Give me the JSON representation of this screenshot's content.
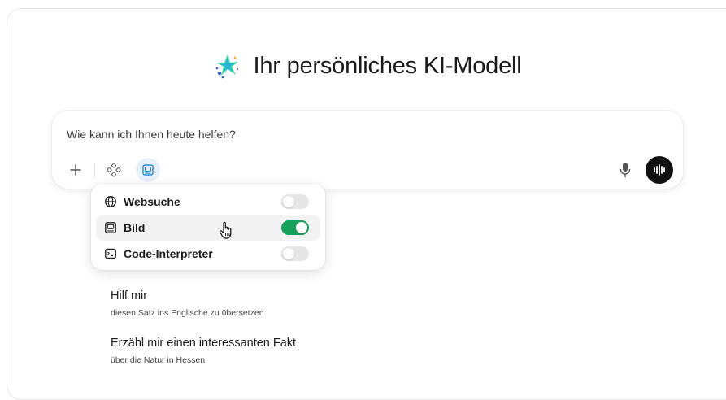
{
  "hero": {
    "title": "Ihr persönliches KI-Modell",
    "logo_icon": "sparkle-logo-icon"
  },
  "composer": {
    "placeholder": "Wie kann ich Ihnen heute helfen?",
    "tools": [
      "plus-icon",
      "apps-icon",
      "image-icon"
    ],
    "right_tools": [
      "microphone-icon",
      "voice-wave-icon"
    ]
  },
  "menu": {
    "items": [
      {
        "label": "Websuche",
        "icon": "globe-icon",
        "enabled": false
      },
      {
        "label": "Bild",
        "icon": "image-icon",
        "enabled": true
      },
      {
        "label": "Code-Interpreter",
        "icon": "terminal-icon",
        "enabled": false
      }
    ]
  },
  "suggestions": [
    {
      "title": "Hilf mir",
      "subtitle": "diesen Satz ins Englische zu übersetzen"
    },
    {
      "title": "Erzähl mir einen interessanten Fakt",
      "subtitle": "über die Natur in Hessen."
    }
  ],
  "colors": {
    "toggle_on": "#16a05a",
    "toggle_off": "#e6e6e6",
    "accent_active": "#e6f1fb",
    "voice_button": "#111111"
  }
}
